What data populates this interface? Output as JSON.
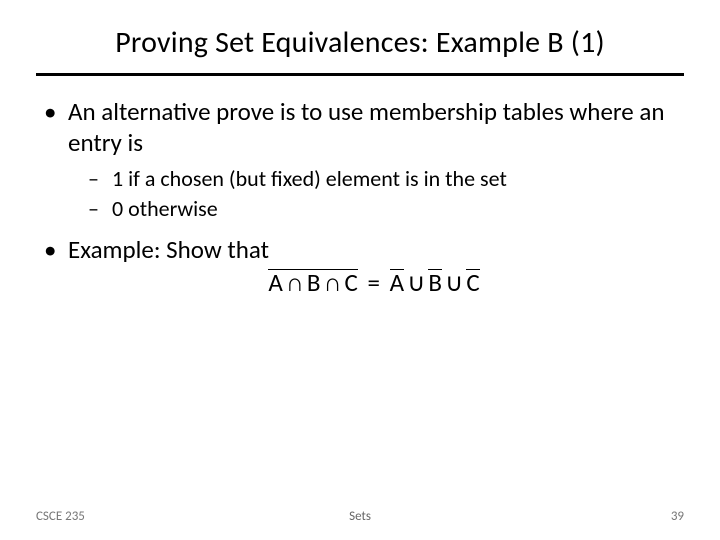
{
  "title": "Proving Set Equivalences: Example B (1)",
  "bullets": {
    "b1_pre": "An alternative prove is to use ",
    "b1_em": "membership tables",
    "b1_post": " where an entry is",
    "s1": "1 if a chosen (but fixed) element is in the set",
    "s2": "0 otherwise",
    "b2": "Example: Show that"
  },
  "formula": {
    "A": "A",
    "B": "B",
    "C": "C",
    "cap": "∩",
    "cup": "∪",
    "eq": "="
  },
  "footer": {
    "left": "CSCE 235",
    "center": "Sets",
    "right": "39"
  }
}
